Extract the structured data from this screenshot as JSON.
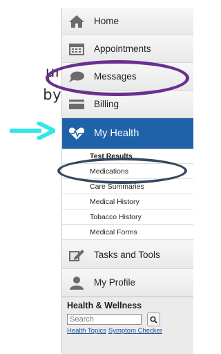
{
  "slide": {
    "line1": "ur",
    "line2": "by",
    "arrow_color": "#33e6e6"
  },
  "menu": {
    "items": [
      {
        "label": "Home",
        "icon": "home-icon"
      },
      {
        "label": "Appointments",
        "icon": "calendar-icon"
      },
      {
        "label": "Messages",
        "icon": "chat-bubble-icon"
      },
      {
        "label": "Billing",
        "icon": "credit-card-icon"
      },
      {
        "label": "My Health",
        "icon": "heartbeat-icon",
        "active": true
      },
      {
        "label": "Tasks and Tools",
        "icon": "pencil-icon"
      },
      {
        "label": "My Profile",
        "icon": "person-icon"
      }
    ],
    "sub_items": [
      "Test Results",
      "Medications",
      "Care Summaries",
      "Medical History",
      "Tobacco History",
      "Medical Forms"
    ]
  },
  "health_wellness": {
    "title": "Health & Wellness",
    "search_placeholder": "Search",
    "links": [
      "Health Topics",
      "Symptom Checker"
    ]
  },
  "colors": {
    "active": "#1f62a9",
    "purple_oval": "#6a2f8f",
    "navy_oval": "#34495e"
  }
}
